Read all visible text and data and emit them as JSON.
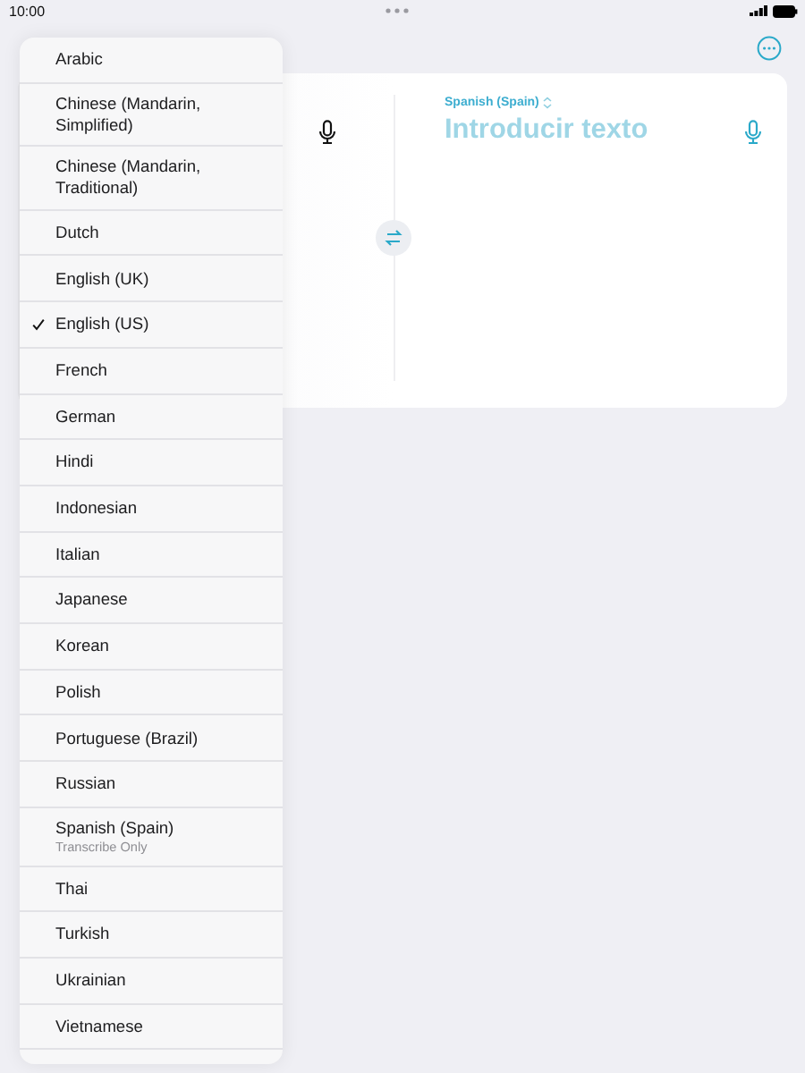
{
  "status_bar": {
    "time": "10:00"
  },
  "target": {
    "language": "Spanish (Spain)",
    "placeholder": "Introducir texto"
  },
  "language_menu": [
    {
      "label": "Arabic",
      "selected": false
    },
    {
      "label": "Chinese (Mandarin, Simplified)",
      "selected": false
    },
    {
      "label": "Chinese (Mandarin, Traditional)",
      "selected": false
    },
    {
      "label": "Dutch",
      "selected": false
    },
    {
      "label": "English (UK)",
      "selected": false
    },
    {
      "label": "English (US)",
      "selected": true
    },
    {
      "label": "French",
      "selected": false
    },
    {
      "label": "German",
      "selected": false
    },
    {
      "label": "Hindi",
      "selected": false
    },
    {
      "label": "Indonesian",
      "selected": false
    },
    {
      "label": "Italian",
      "selected": false
    },
    {
      "label": "Japanese",
      "selected": false
    },
    {
      "label": "Korean",
      "selected": false
    },
    {
      "label": "Polish",
      "selected": false
    },
    {
      "label": "Portuguese (Brazil)",
      "selected": false
    },
    {
      "label": "Russian",
      "selected": false
    },
    {
      "label": "Spanish (Spain)",
      "note": "Transcribe Only",
      "selected": false
    },
    {
      "label": "Thai",
      "selected": false
    },
    {
      "label": "Turkish",
      "selected": false
    },
    {
      "label": "Ukrainian",
      "selected": false
    },
    {
      "label": "Vietnamese",
      "selected": false
    }
  ]
}
